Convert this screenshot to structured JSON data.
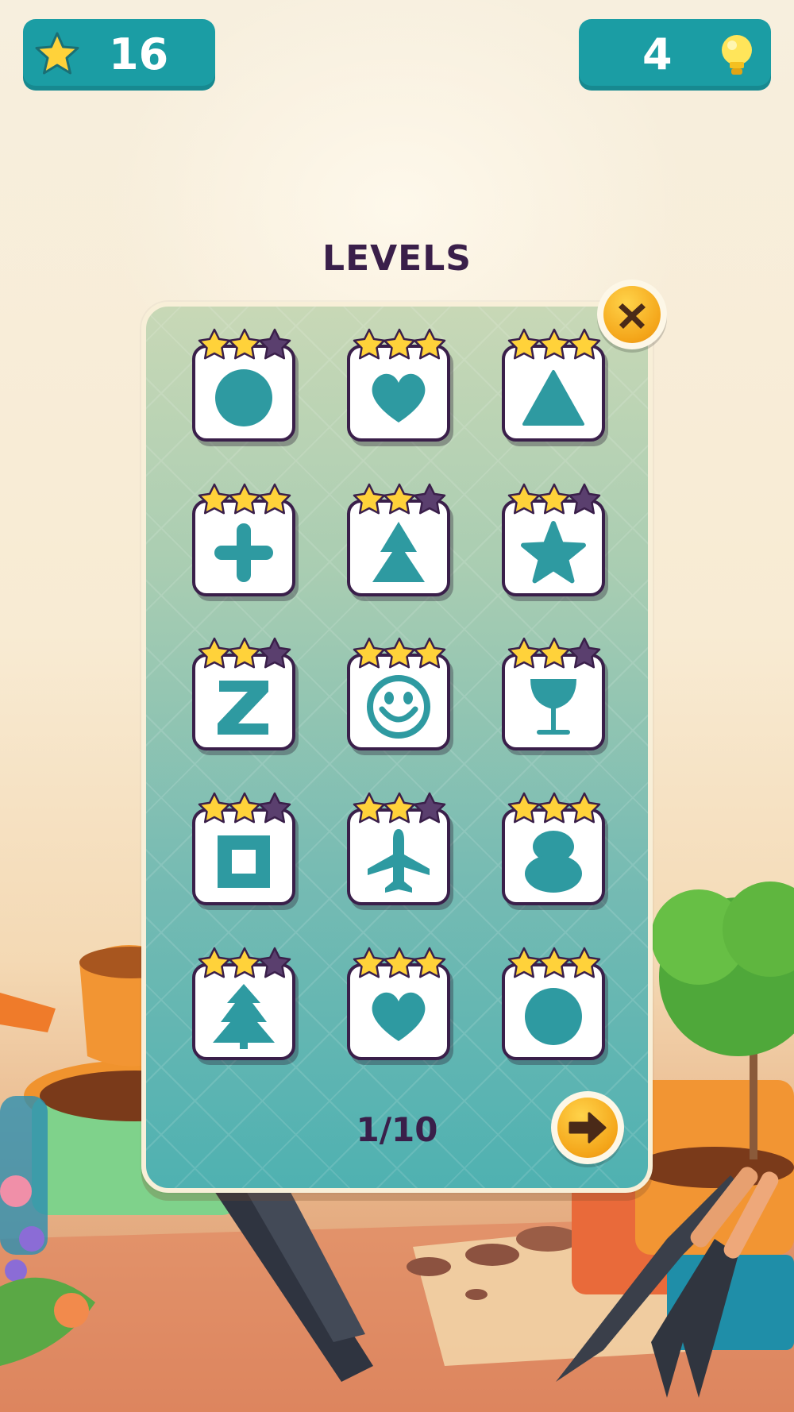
{
  "colors": {
    "teal": "#1b9da4",
    "shape": "#2e9aa1",
    "star_on": "#ffd23a",
    "star_off": "#5a3f6e",
    "text_dark": "#3a1f4a",
    "button_orange": "#f4a519"
  },
  "hud": {
    "stars_icon": "star-icon",
    "stars_count": "16",
    "hints_count": "4",
    "hints_icon": "lightbulb-icon"
  },
  "title": "LEVELS",
  "pagination": {
    "label": "1/10",
    "next_icon": "arrow-right-icon",
    "close_icon": "close-icon"
  },
  "levels": [
    {
      "shape": "circle",
      "stars": 2
    },
    {
      "shape": "heart",
      "stars": 3
    },
    {
      "shape": "triangle",
      "stars": 3
    },
    {
      "shape": "plus",
      "stars": 3
    },
    {
      "shape": "tree-triangles",
      "stars": 2
    },
    {
      "shape": "star",
      "stars": 2
    },
    {
      "shape": "letter-z",
      "stars": 2
    },
    {
      "shape": "smiley",
      "stars": 3
    },
    {
      "shape": "glass",
      "stars": 2
    },
    {
      "shape": "square-outline",
      "stars": 2
    },
    {
      "shape": "airplane",
      "stars": 2
    },
    {
      "shape": "eight",
      "stars": 3
    },
    {
      "shape": "pine-tree",
      "stars": 2
    },
    {
      "shape": "heart",
      "stars": 3
    },
    {
      "shape": "circle",
      "stars": 3
    }
  ]
}
